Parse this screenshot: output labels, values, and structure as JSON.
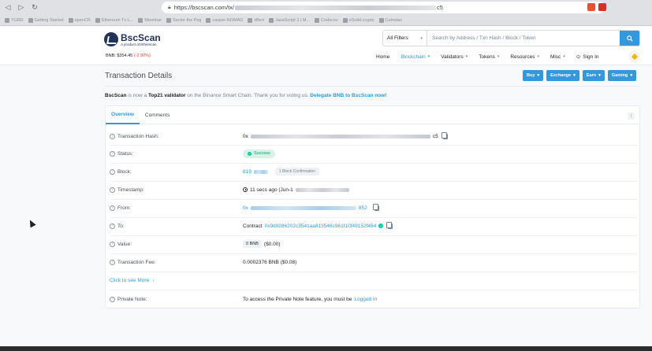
{
  "browser": {
    "url_prefix": "https://bscscan.com/tx/",
    "url_suffix": "c5",
    "bookmarks": [
      "TGRD",
      "Getting Started",
      "openCR",
      "Ethereum Tx L...",
      "Moonbar",
      "Sector the Peg",
      "casper-NOMAD",
      "xBert",
      "JavaScript 3 | M...",
      "Codecov",
      "eSolid.crypto",
      "Coinstax"
    ]
  },
  "header": {
    "logo_name": "BscScan",
    "logo_sub": "A product of Etherscan",
    "price_label": "BNB: $354.45",
    "price_change": "(-2.90%)",
    "filter_label": "All Filters",
    "search_placeholder": "Search by Address / Txn Hash / Block / Token",
    "nav": {
      "home": "Home",
      "blockchain": "Blockchain",
      "validators": "Validators",
      "tokens": "Tokens",
      "resources": "Resources",
      "misc": "Misc",
      "signin": "Sign In"
    }
  },
  "page": {
    "title": "Transaction Details",
    "buttons": {
      "buy": "Buy",
      "exchange": "Exchange",
      "earn": "Earn",
      "gaming": "Gaming"
    },
    "notice": {
      "brand": "BscScan",
      "part1": " is now a ",
      "bold": "Top21 validator",
      "part2": " on the Binance Smart Chain. Thank you for voting us. ",
      "link": "Delegate BNB to BscScan now!"
    }
  },
  "tabs": {
    "overview": "Overview",
    "comments": "Comments",
    "more": "⁝"
  },
  "details": {
    "tx_hash": {
      "label": "Transaction Hash:",
      "prefix": "0x",
      "suffix": "c5"
    },
    "status": {
      "label": "Status:",
      "value": "Success"
    },
    "block": {
      "label": "Block:",
      "value": "819",
      "confirmations": "1 Block Confirmation"
    },
    "timestamp": {
      "label": "Timestamp:",
      "value": "11 secs ago (Jun-1"
    },
    "from": {
      "label": "From:",
      "prefix": "0x",
      "suffix": "852"
    },
    "to": {
      "label": "To:",
      "prefix": "Contract",
      "address": "0x9d9286202c3541aa813546c961f10f49152f484"
    },
    "value": {
      "label": "Value:",
      "amount": "0 BNB",
      "usd": "($0.00)"
    },
    "fee": {
      "label": "Transaction Fee:",
      "value": "0.0002376 BNB ($0.08)"
    },
    "see_more": "Click to see More",
    "private_note": {
      "label": "Private Note:",
      "text": "To access the Private Note feature, you must be",
      "link": "Logged In"
    }
  }
}
